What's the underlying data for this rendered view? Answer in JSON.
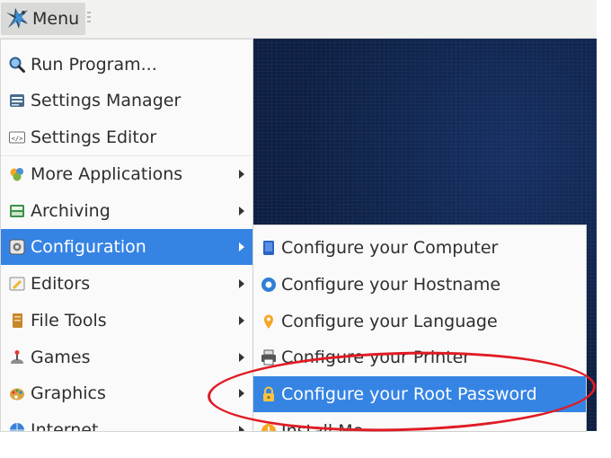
{
  "panel": {
    "menu_label": "Menu"
  },
  "menu": {
    "items": [
      {
        "label": "Run Program...",
        "icon": "search-icon"
      },
      {
        "label": "Settings Manager",
        "icon": "settings-manager-icon"
      },
      {
        "label": "Settings Editor",
        "icon": "code-icon"
      },
      {
        "label": "More Applications",
        "icon": "more-apps-icon",
        "submenu": true
      },
      {
        "label": "Archiving",
        "icon": "archive-icon",
        "submenu": true
      },
      {
        "label": "Configuration",
        "icon": "configuration-icon",
        "submenu": true,
        "active": true
      },
      {
        "label": "Editors",
        "icon": "editor-icon",
        "submenu": true
      },
      {
        "label": "File Tools",
        "icon": "file-tools-icon",
        "submenu": true
      },
      {
        "label": "Games",
        "icon": "games-icon",
        "submenu": true
      },
      {
        "label": "Graphics",
        "icon": "graphics-icon",
        "submenu": true
      },
      {
        "label": "Internet",
        "icon": "internet-icon",
        "submenu": true
      }
    ]
  },
  "submenu": {
    "items": [
      {
        "label": "Configure your Computer",
        "icon": "computer-icon"
      },
      {
        "label": "Configure your Hostname",
        "icon": "hostname-icon"
      },
      {
        "label": "Configure your Language",
        "icon": "location-pin-icon"
      },
      {
        "label": "Configure your Printer",
        "icon": "printer-icon"
      },
      {
        "label": "Configure your Root Password",
        "icon": "lock-icon",
        "active": true
      },
      {
        "label": "Install Me",
        "icon": "install-icon"
      }
    ]
  },
  "colors": {
    "selection": "#3584e4",
    "annotation": "#e01b24",
    "desktop": "#0d1f42"
  }
}
